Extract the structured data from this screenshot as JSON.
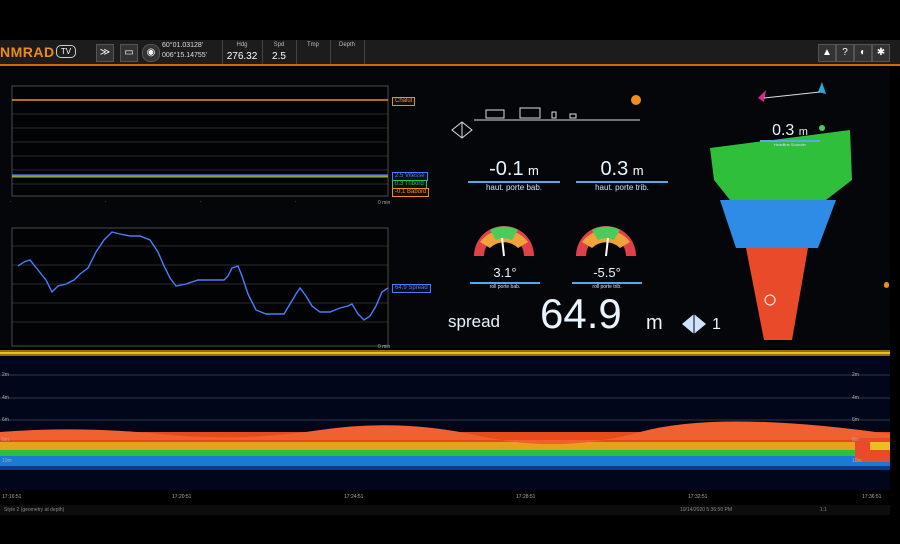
{
  "toolbar": {
    "brand": "NMRAD",
    "tv_label": "TV",
    "position": {
      "lat": "60°01.03128'",
      "lon": "006°15.14755'"
    },
    "hdg": {
      "label": "Hdg",
      "value": "276.32"
    },
    "spd": {
      "label": "Spd",
      "value": "2.5"
    },
    "tmp": {
      "label": "Tmp"
    },
    "depth": {
      "label": "Depth"
    },
    "right_icons": [
      "warning-icon",
      "help-icon",
      "hide-icon",
      "settings-icon"
    ]
  },
  "chart1": {
    "legend": [
      {
        "label": "Chalut",
        "color": "#f28c1c"
      },
      {
        "label": "2.5 Vitesse",
        "color": "#4a7dff"
      },
      {
        "label": "0.3 Tribord",
        "color": "#25c45a"
      },
      {
        "label": "-0.1 Babord",
        "color": "#f28c1c"
      }
    ],
    "x_end_label": "0 min"
  },
  "chart2": {
    "legend": [
      {
        "label": "64.9 Spread",
        "color": "#4a7dff"
      }
    ],
    "x_end_label": "0 min"
  },
  "door_metrics": {
    "port_height": {
      "value": "-0.1",
      "unit": "m",
      "label": "haut. porte bab."
    },
    "stbd_height": {
      "value": "0.3",
      "unit": "m",
      "label": "haut. porte trib."
    },
    "port_roll": {
      "value": "3.1°",
      "label": "roll porte bab."
    },
    "stbd_roll": {
      "value": "-5.5°",
      "label": "roll porte trib."
    }
  },
  "spread": {
    "label": "spread",
    "value": "64.9",
    "unit": "m",
    "index": "1"
  },
  "trawl": {
    "value": "0.3",
    "unit": "m",
    "sublabel": "Headline Sounder"
  },
  "echogram": {
    "depth_labels_left": [
      "2m",
      "4m",
      "6m",
      "8m",
      "10m"
    ],
    "depth_labels_right": [
      "2m",
      "4m",
      "6m",
      "8m",
      "10m"
    ],
    "time_labels": [
      "17:16:51",
      "17:20:51",
      "17:24:51",
      "17:28:51",
      "17:32:51",
      "17:36:51"
    ]
  },
  "statusbar": {
    "left_text": "Style 2 (geometry at depth)",
    "date_text": "10/14/2020 5:36:50 PM",
    "right_text": "1:1"
  }
}
